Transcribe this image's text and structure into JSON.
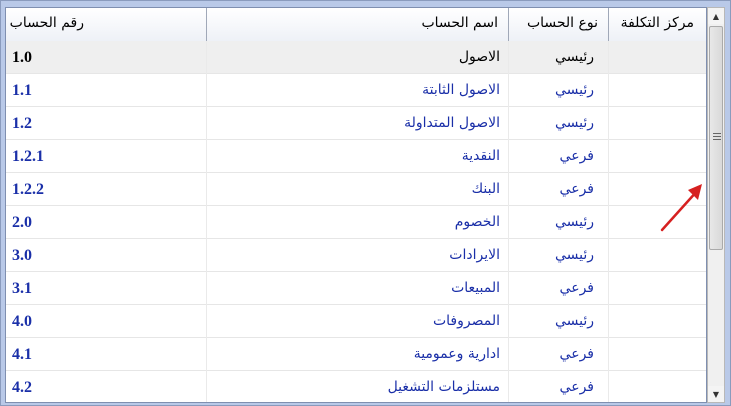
{
  "columns": {
    "code": "رقم الحساب",
    "name": "اسم الحساب",
    "type": "نوع الحساب",
    "cost_center": "مركز التكلفة"
  },
  "rows": [
    {
      "code": "1.0",
      "name": "الاصول",
      "type": "رئيسي",
      "cost_center": "",
      "selected": true
    },
    {
      "code": "1.1",
      "name": "الاصول الثابتة",
      "type": "رئيسي",
      "cost_center": ""
    },
    {
      "code": "1.2",
      "name": "الاصول المتداولة",
      "type": "رئيسي",
      "cost_center": ""
    },
    {
      "code": "1.2.1",
      "name": "النقدية",
      "type": "فرعي",
      "cost_center": ""
    },
    {
      "code": "1.2.2",
      "name": "البنك",
      "type": "فرعي",
      "cost_center": ""
    },
    {
      "code": "2.0",
      "name": "الخصوم",
      "type": "رئيسي",
      "cost_center": ""
    },
    {
      "code": "3.0",
      "name": "الايرادات",
      "type": "رئيسي",
      "cost_center": ""
    },
    {
      "code": "3.1",
      "name": "المبيعات",
      "type": "فرعي",
      "cost_center": ""
    },
    {
      "code": "4.0",
      "name": "المصروفات",
      "type": "رئيسي",
      "cost_center": ""
    },
    {
      "code": "4.1",
      "name": "ادارية وعمومية",
      "type": "فرعي",
      "cost_center": ""
    },
    {
      "code": "4.2",
      "name": "مستلزمات التشغيل",
      "type": "فرعي",
      "cost_center": ""
    }
  ],
  "colors": {
    "selected_text": "#000000",
    "row_text": "#1a2fa8",
    "annotation_arrow": "#d62020"
  },
  "icons": {
    "scroll_up": "triangle-up",
    "scroll_down": "triangle-down",
    "annotation": "red-arrow"
  }
}
